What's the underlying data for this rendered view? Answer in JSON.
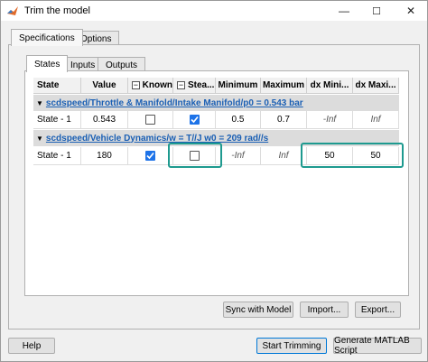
{
  "window": {
    "title": "Trim the model",
    "minimize": "—",
    "maximize": "☐",
    "close": "✕"
  },
  "tabs_outer": [
    "Specifications",
    "Options"
  ],
  "tabs_inner": [
    "States",
    "Inputs",
    "Outputs"
  ],
  "columns": [
    "State",
    "Value",
    "Known",
    "Stea...",
    "Minimum",
    "Maximum",
    "dx Mini...",
    "dx Maxi..."
  ],
  "groups": [
    {
      "label": "scdspeed/Throttle & Manifold/Intake Manifold/p0 = 0.543 bar",
      "row": {
        "state": "State - 1",
        "value": "0.543",
        "known": false,
        "steady": true,
        "minimum": "0.5",
        "maximum": "0.7",
        "dx_min": "-Inf",
        "dx_max": "Inf"
      }
    },
    {
      "label": "scdspeed/Vehicle Dynamics/w = T//J w0 = 209 rad//s",
      "row": {
        "state": "State - 1",
        "value": "180",
        "known": true,
        "steady": false,
        "minimum": "-Inf",
        "maximum": "Inf",
        "dx_min": "50",
        "dx_max": "50"
      }
    }
  ],
  "buttons": {
    "sync": "Sync with Model",
    "import": "Import...",
    "export": "Export...",
    "help": "Help",
    "start": "Start Trimming",
    "generate": "Generate MATLAB Script"
  },
  "colors": {
    "highlight": "#1e9a8f",
    "check": "#1e73e8",
    "link": "#1a5fb4"
  }
}
